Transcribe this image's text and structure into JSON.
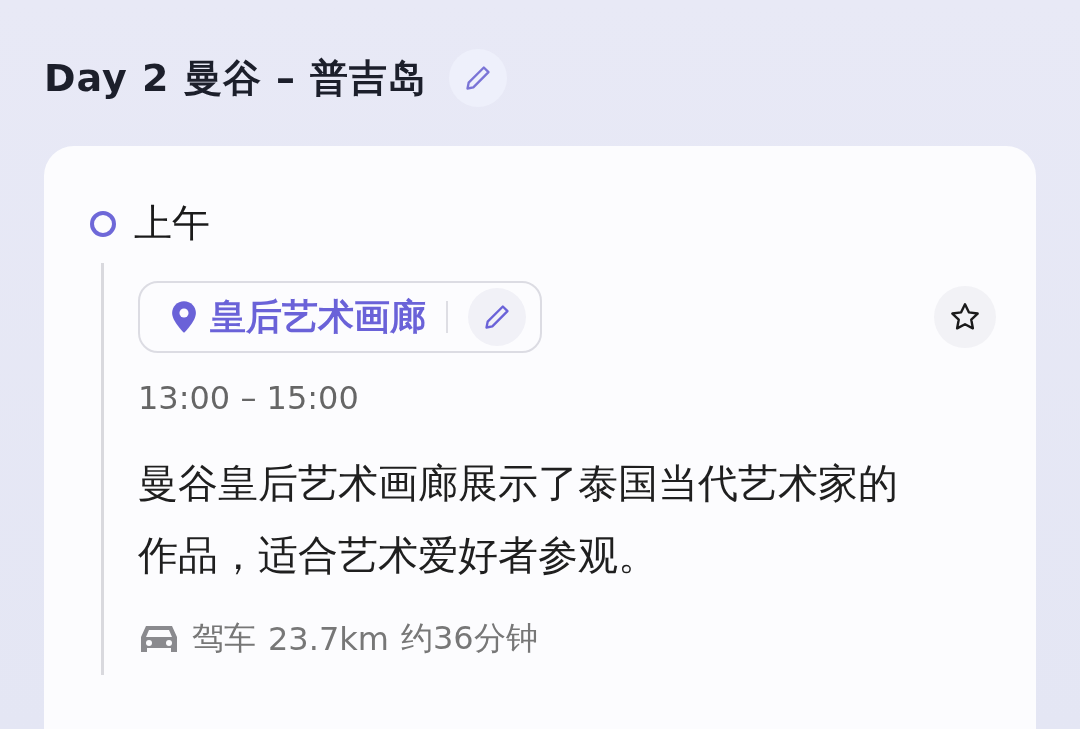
{
  "day": {
    "title": "Day 2 曼谷 – 普吉岛"
  },
  "periods": [
    {
      "label": "上午",
      "stops": [
        {
          "place": "皇后艺术画廊",
          "starred": false,
          "time": "13:00 – 15:00",
          "description": "曼谷皇后艺术画廊展示了泰国当代艺术家的作品，适合艺术爱好者参观。",
          "transport": {
            "kind": "car",
            "mode": "驾车",
            "distance": "23.7km",
            "duration": "约36分钟"
          }
        }
      ]
    }
  ]
}
